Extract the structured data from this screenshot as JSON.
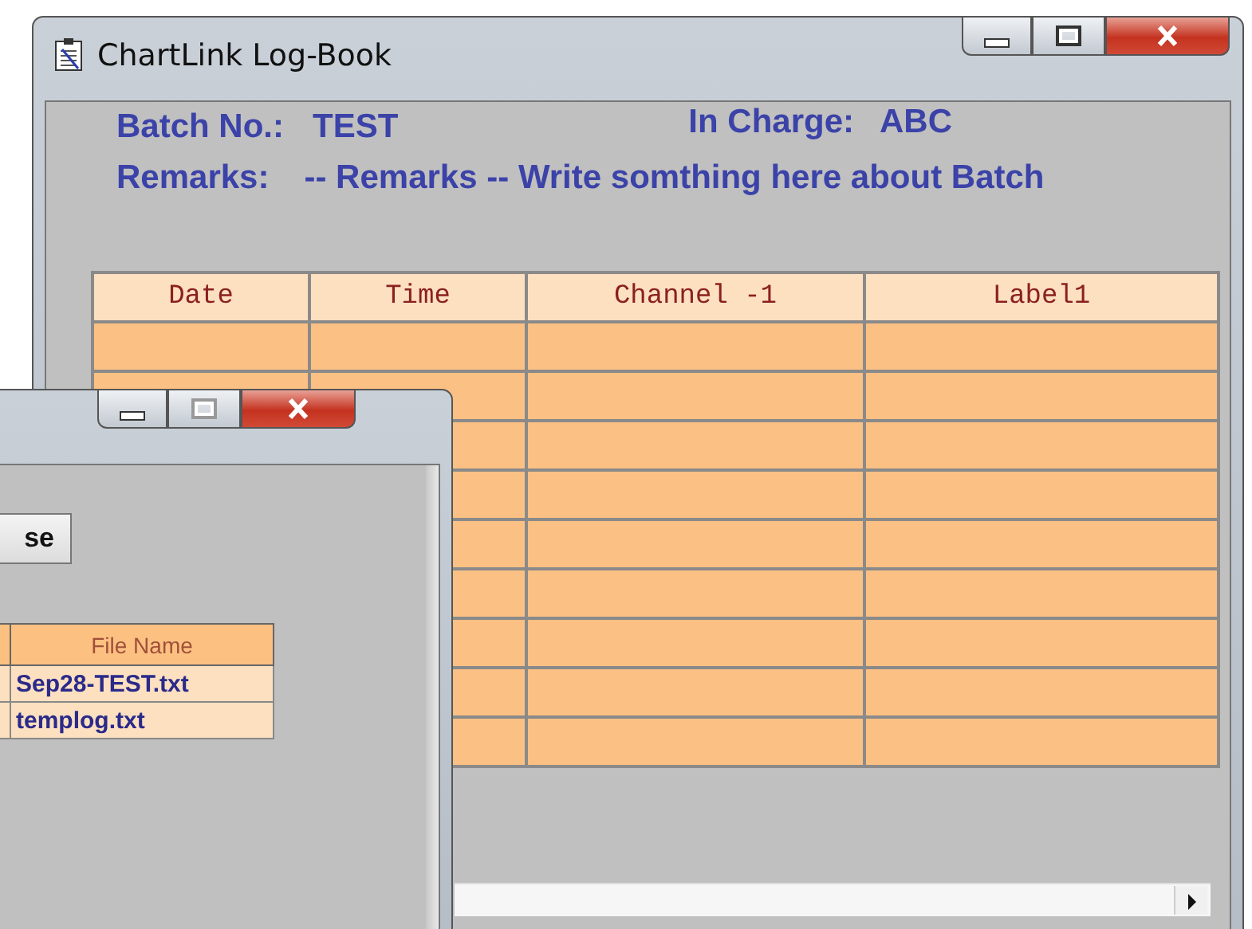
{
  "main_window": {
    "title": "ChartLink  Log-Book",
    "batch": {
      "label": "Batch No.:",
      "value": "TEST"
    },
    "in_charge": {
      "label": "In Charge:",
      "value": "ABC"
    },
    "remarks": {
      "label": "Remarks:",
      "value": "-- Remarks -- Write somthing here about Batch"
    },
    "table": {
      "columns": [
        "Date",
        "Time",
        "Channel -1",
        "Label1"
      ],
      "rows": [
        {},
        {},
        {},
        {},
        {},
        {},
        {},
        {},
        {}
      ]
    }
  },
  "file_window": {
    "button": "se",
    "table": {
      "columns": [
        {
          "kind": "blank"
        },
        {
          "kind": "text",
          "label": "File Name"
        }
      ],
      "rows": [
        {
          "file_name": "Sep28-TEST.txt"
        },
        {
          "file_name": "templog.txt"
        }
      ]
    }
  }
}
